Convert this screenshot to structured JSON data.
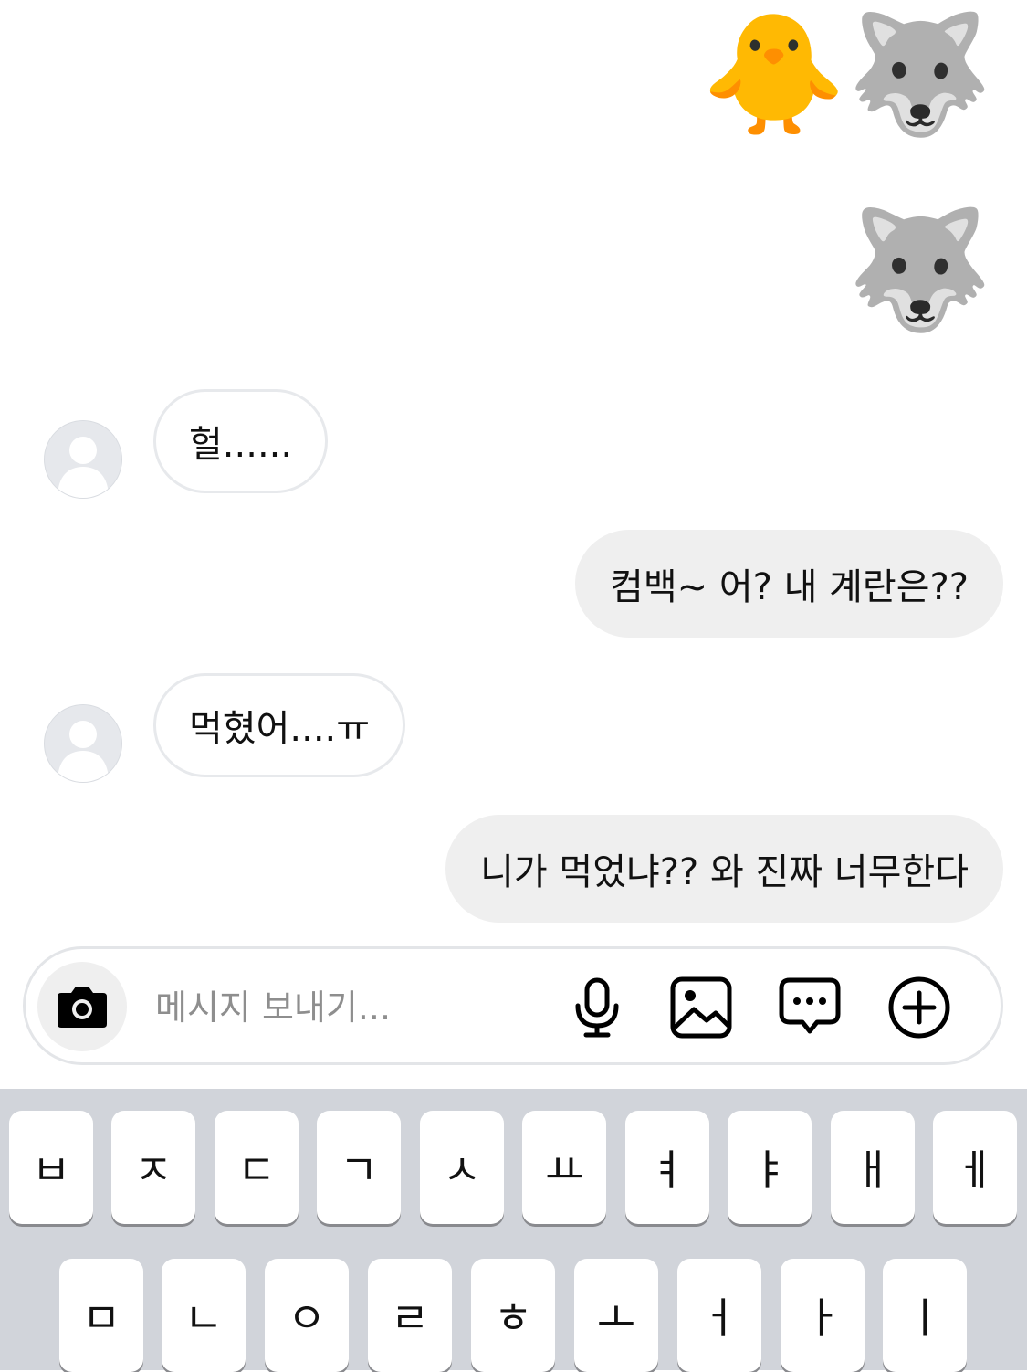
{
  "messages": {
    "sticker_top": "🐥🐺",
    "sticker_second": "🐺",
    "incoming_1": "헐......",
    "outgoing_1": "컴백~ 어? 내 계란은??",
    "incoming_2": "먹혔어....ㅠ",
    "outgoing_2": "니가 먹었냐?? 와 진짜 너무한다"
  },
  "composer": {
    "placeholder": "메시지 보내기...",
    "icons": [
      "camera-icon",
      "microphone-icon",
      "gallery-icon",
      "sticker-chat-icon",
      "plus-icon"
    ]
  },
  "keyboard": {
    "row1": [
      "ㅂ",
      "ㅈ",
      "ㄷ",
      "ㄱ",
      "ㅅ",
      "ㅛ",
      "ㅕ",
      "ㅑ",
      "ㅐ",
      "ㅔ"
    ],
    "row2": [
      "ㅁ",
      "ㄴ",
      "ㅇ",
      "ㄹ",
      "ㅎ",
      "ㅗ",
      "ㅓ",
      "ㅏ",
      "ㅣ"
    ]
  },
  "colors": {
    "outgoing_bubble": "#efefef",
    "incoming_border": "#e7e9ec",
    "keyboard_bg": "#d1d4da",
    "key_bg": "#ffffff"
  }
}
